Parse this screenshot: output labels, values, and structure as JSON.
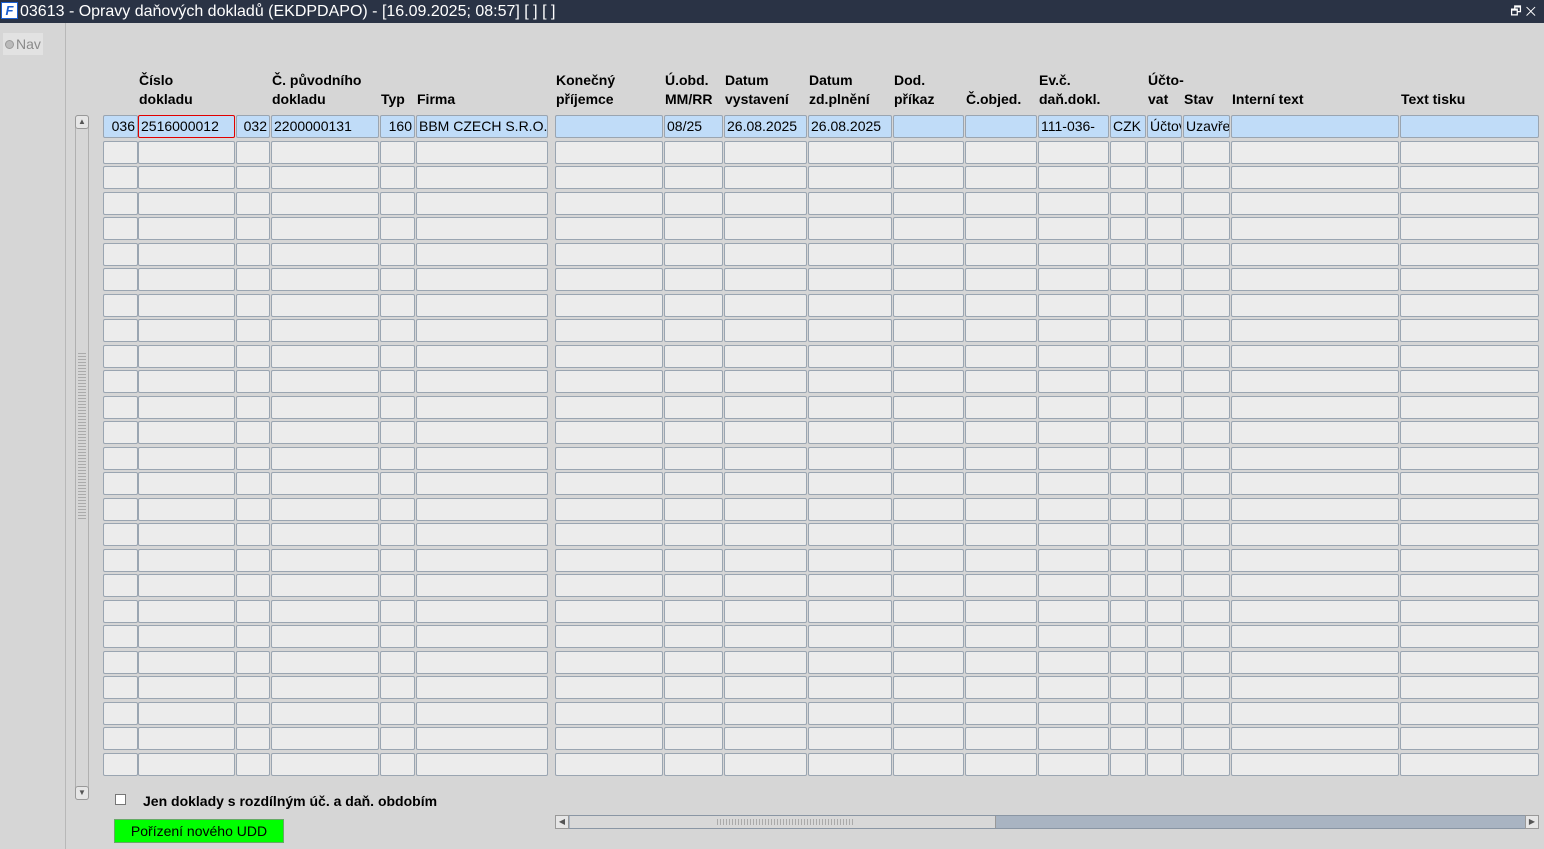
{
  "window": {
    "title": "03613 - Opravy daňových dokladů (EKDPDAPO) - [16.09.2025; 08:57]  [ ]  [ ]",
    "controls": "🗗✕"
  },
  "nav": {
    "label": "Nav"
  },
  "table": {
    "headers": [
      "",
      "Číslo\ndokladu",
      "",
      "Č. původního\ndokladu",
      "Typ",
      "Firma",
      "Konečný\npříjemce",
      "Ú.obd.\nMM/RR",
      "Datum\nvystavení",
      "Datum\nzd.plnění",
      "Dod.\npříkaz",
      "Č.objed.",
      "Ev.č.\ndaň.dokl.",
      "",
      "Účto-\nvat",
      "Stav",
      "Interní text",
      "Text tisku"
    ],
    "row_count": 26,
    "rows": [
      [
        "036",
        "2516000012",
        "032",
        "2200000131",
        "160",
        "BBM CZECH S.R.O.",
        "",
        "08/25",
        "26.08.2025",
        "26.08.2025",
        "",
        "",
        "111-036-",
        "CZK",
        "Účtovat",
        "Uzavřeno",
        "",
        ""
      ]
    ]
  },
  "filter": {
    "checkbox_label": "Jen doklady s rozdílným úč. a daň. obdobím",
    "checked": false
  },
  "buttons": {
    "new_udd": "Pořízení nového UDD"
  },
  "colors": {
    "selected_row": "#c0dcf8",
    "button_green": "#00ff00",
    "titlebar": "#2a3345"
  }
}
